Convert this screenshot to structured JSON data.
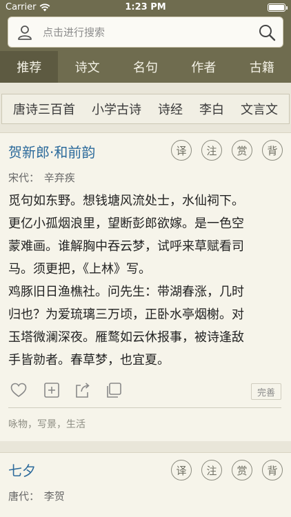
{
  "status": {
    "carrier": "Carrier",
    "time": "1:23 PM"
  },
  "search": {
    "placeholder": "点击进行搜索"
  },
  "tabs": [
    "推荐",
    "诗文",
    "名句",
    "作者",
    "古籍"
  ],
  "categories": [
    "唐诗三百首",
    "小学古诗",
    "诗经",
    "李白",
    "文言文"
  ],
  "cards": [
    {
      "title": "贺新郎·和前韵",
      "badges": [
        "译",
        "注",
        "赏",
        "背"
      ],
      "dynasty": "宋代：",
      "author": "辛弃疾",
      "lines": [
        "觅句如东野。想钱塘风流处士，水仙祠下。",
        "更亿小孤烟浪里，望断彭郎欲嫁。是一色空",
        "蒙难画。谁解胸中吞云梦，试呼来草赋看司",
        "马。须更把，《上林》写。",
        "鸡豚旧日渔樵社。问先生：带湖春涨，几时",
        "归也？为爱琉璃三万顷，正卧水亭烟榭。对",
        "玉塔微澜深夜。雁鹜如云休报事，被诗逢敌",
        "手皆勍者。春草梦，也宜夏。"
      ],
      "improve_label": "完善",
      "tags": "咏物，写景，生活"
    },
    {
      "title": "七夕",
      "badges": [
        "译",
        "注",
        "赏",
        "背"
      ],
      "dynasty": "唐代：",
      "author": "李贺"
    }
  ],
  "colors": {
    "header": "#6f6c4f",
    "title": "#2c6a9b",
    "background": "#e9e6d9"
  }
}
